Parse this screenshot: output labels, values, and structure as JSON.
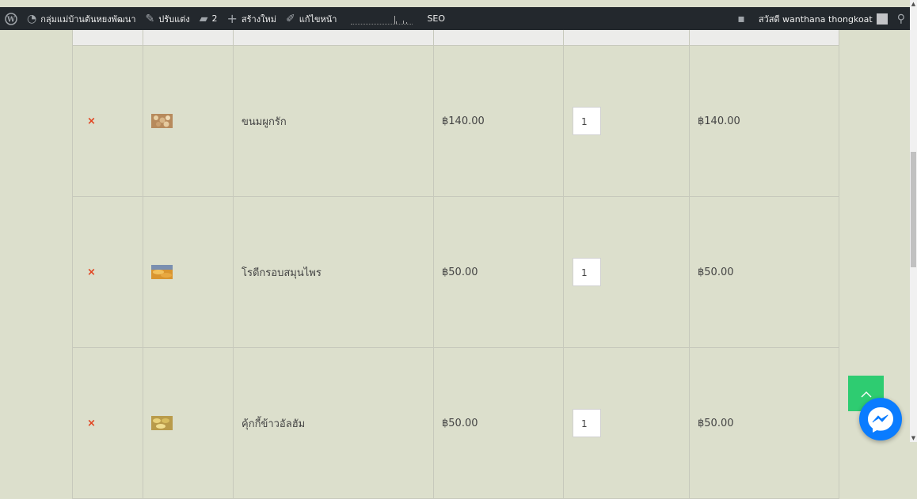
{
  "adminbar": {
    "site_name": "กลุ่มแม่บ้านต้นหยงพัฒนา",
    "customize": "ปรับแต่ง",
    "comments_count": "2",
    "new_label": "สร้างใหม่",
    "edit_page": "แก้ไขหน้า",
    "seo": "SEO",
    "greeting": "สวัสดี wanthana thongkoat"
  },
  "cart": {
    "items": [
      {
        "remove": "×",
        "name": "ขนมผูกรัก",
        "price": "฿140.00",
        "quantity": "1",
        "subtotal": "฿140.00"
      },
      {
        "remove": "×",
        "name": "โรตีกรอบสมุนไพร",
        "price": "฿50.00",
        "quantity": "1",
        "subtotal": "฿50.00"
      },
      {
        "remove": "×",
        "name": "คุ้กกี้ข้าวอัลฮัม",
        "price": "฿50.00",
        "quantity": "1",
        "subtotal": "฿50.00"
      }
    ]
  },
  "colors": {
    "accent_green": "#2ecc71",
    "messenger_blue": "#0a7cff",
    "remove_red": "#e2401c",
    "page_bg": "#dcdfcc"
  },
  "icons": [
    "wordpress-icon",
    "dashboard-icon",
    "brush-icon",
    "comment-icon",
    "plus-icon",
    "pencil-icon",
    "notification-icon",
    "search-icon",
    "arrow-up-icon",
    "messenger-icon"
  ]
}
